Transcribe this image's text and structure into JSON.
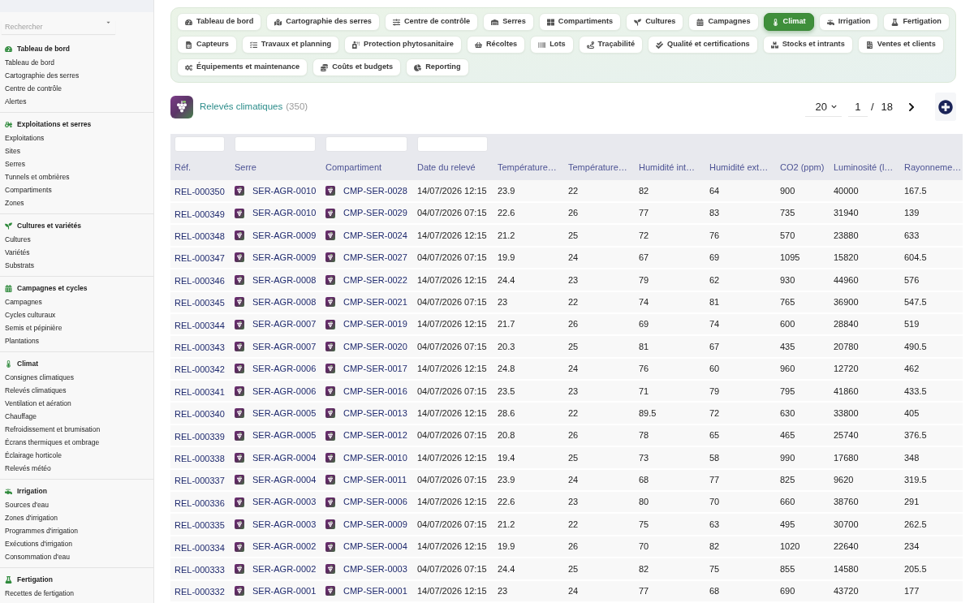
{
  "sidebar": {
    "search": {
      "placeholder": "Rechercher"
    },
    "sections": [
      {
        "title": "Tableau de bord",
        "items": [
          "Tableau de bord",
          "Cartographie des serres",
          "Centre de contrôle",
          "Alertes"
        ]
      },
      {
        "title": "Exploitations et serres",
        "items": [
          "Exploitations",
          "Sites",
          "Serres",
          "Tunnels et ombrières",
          "Compartiments",
          "Zones"
        ]
      },
      {
        "title": "Cultures et variétés",
        "items": [
          "Cultures",
          "Variétés",
          "Substrats"
        ]
      },
      {
        "title": "Campagnes et cycles",
        "items": [
          "Campagnes",
          "Cycles culturaux",
          "Semis et pépinière",
          "Plantations"
        ]
      },
      {
        "title": "Climat",
        "items": [
          "Consignes climatiques",
          "Relevés climatiques",
          "Ventilation et aération",
          "Chauffage",
          "Refroidissement et brumisation",
          "Écrans thermiques et ombrage",
          "Éclairage horticole",
          "Relevés météo"
        ]
      },
      {
        "title": "Irrigation",
        "items": [
          "Sources d'eau",
          "Zones d'irrigation",
          "Programmes d'irrigation",
          "Exécutions d'irrigation",
          "Consommation d'eau"
        ]
      },
      {
        "title": "Fertigation",
        "items": [
          "Recettes de fertigation"
        ]
      }
    ]
  },
  "nav": {
    "tabs": [
      {
        "label": "Tableau de bord",
        "selected": false
      },
      {
        "label": "Cartographie des serres",
        "selected": false
      },
      {
        "label": "Centre de contrôle",
        "selected": false
      },
      {
        "label": "Serres",
        "selected": false
      },
      {
        "label": "Compartiments",
        "selected": false
      },
      {
        "label": "Cultures",
        "selected": false
      },
      {
        "label": "Campagnes",
        "selected": false
      },
      {
        "label": "Climat",
        "selected": true
      },
      {
        "label": "Irrigation",
        "selected": false
      },
      {
        "label": "Fertigation",
        "selected": false
      },
      {
        "label": "Capteurs",
        "selected": false
      },
      {
        "label": "Travaux et planning",
        "selected": false
      },
      {
        "label": "Protection phytosanitaire",
        "selected": false
      },
      {
        "label": "Récoltes",
        "selected": false
      },
      {
        "label": "Lots",
        "selected": false
      },
      {
        "label": "Traçabilité",
        "selected": false
      },
      {
        "label": "Qualité et certifications",
        "selected": false
      },
      {
        "label": "Stocks et intrants",
        "selected": false
      },
      {
        "label": "Ventes et clients",
        "selected": false
      },
      {
        "label": "Équipements et maintenance",
        "selected": false
      },
      {
        "label": "Coûts et budgets",
        "selected": false
      },
      {
        "label": "Reporting",
        "selected": false
      }
    ]
  },
  "header": {
    "title": "Relevés climatiques",
    "count": "(350)"
  },
  "pagination": {
    "page_size": "20",
    "page": "1",
    "separator": "/",
    "total_pages": "18"
  },
  "table": {
    "columns": [
      {
        "label": "Réf.",
        "kind": "link",
        "filter": true
      },
      {
        "label": "Serre",
        "kind": "icon_link",
        "filter": true
      },
      {
        "label": "Compartiment",
        "kind": "icon_link",
        "filter": true
      },
      {
        "label": "Date du relevé",
        "kind": "text",
        "filter": true
      },
      {
        "label": "Température…",
        "kind": "text",
        "filter": false
      },
      {
        "label": "Température…",
        "kind": "text",
        "filter": false
      },
      {
        "label": "Humidité int…",
        "kind": "text",
        "filter": false
      },
      {
        "label": "Humidité ext…",
        "kind": "text",
        "filter": false
      },
      {
        "label": "CO2 (ppm)",
        "kind": "text",
        "filter": false
      },
      {
        "label": "Luminosité (l…",
        "kind": "text",
        "filter": false
      },
      {
        "label": "Rayonneme…",
        "kind": "text",
        "filter": false
      }
    ],
    "rows": [
      [
        "REL-000350",
        "SER-AGR-0010",
        "CMP-SER-0028",
        "14/07/2026 12:15",
        "23.9",
        "22",
        "82",
        "64",
        "900",
        "40000",
        "167.5"
      ],
      [
        "REL-000349",
        "SER-AGR-0010",
        "CMP-SER-0029",
        "04/07/2026 07:15",
        "22.6",
        "26",
        "77",
        "83",
        "735",
        "31940",
        "139"
      ],
      [
        "REL-000348",
        "SER-AGR-0009",
        "CMP-SER-0024",
        "14/07/2026 12:15",
        "21.2",
        "25",
        "72",
        "76",
        "570",
        "23880",
        "633"
      ],
      [
        "REL-000347",
        "SER-AGR-0009",
        "CMP-SER-0027",
        "04/07/2026 07:15",
        "19.9",
        "24",
        "67",
        "69",
        "1095",
        "15820",
        "604.5"
      ],
      [
        "REL-000346",
        "SER-AGR-0008",
        "CMP-SER-0022",
        "14/07/2026 12:15",
        "24.4",
        "23",
        "79",
        "62",
        "930",
        "44960",
        "576"
      ],
      [
        "REL-000345",
        "SER-AGR-0008",
        "CMP-SER-0021",
        "04/07/2026 07:15",
        "23",
        "22",
        "74",
        "81",
        "765",
        "36900",
        "547.5"
      ],
      [
        "REL-000344",
        "SER-AGR-0007",
        "CMP-SER-0019",
        "14/07/2026 12:15",
        "21.7",
        "26",
        "69",
        "74",
        "600",
        "28840",
        "519"
      ],
      [
        "REL-000343",
        "SER-AGR-0007",
        "CMP-SER-0020",
        "04/07/2026 07:15",
        "20.3",
        "25",
        "81",
        "67",
        "435",
        "20780",
        "490.5"
      ],
      [
        "REL-000342",
        "SER-AGR-0006",
        "CMP-SER-0017",
        "14/07/2026 12:15",
        "24.8",
        "24",
        "76",
        "60",
        "960",
        "12720",
        "462"
      ],
      [
        "REL-000341",
        "SER-AGR-0006",
        "CMP-SER-0016",
        "04/07/2026 07:15",
        "23.5",
        "23",
        "71",
        "79",
        "795",
        "41860",
        "433.5"
      ],
      [
        "REL-000340",
        "SER-AGR-0005",
        "CMP-SER-0013",
        "14/07/2026 12:15",
        "28.6",
        "22",
        "89.5",
        "72",
        "630",
        "33800",
        "405"
      ],
      [
        "REL-000339",
        "SER-AGR-0005",
        "CMP-SER-0012",
        "04/07/2026 07:15",
        "20.8",
        "26",
        "78",
        "65",
        "465",
        "25740",
        "376.5"
      ],
      [
        "REL-000338",
        "SER-AGR-0004",
        "CMP-SER-0010",
        "14/07/2026 12:15",
        "19.4",
        "25",
        "73",
        "58",
        "990",
        "17680",
        "348"
      ],
      [
        "REL-000337",
        "SER-AGR-0004",
        "CMP-SER-0011",
        "04/07/2026 07:15",
        "23.9",
        "24",
        "68",
        "77",
        "825",
        "9620",
        "319.5"
      ],
      [
        "REL-000336",
        "SER-AGR-0003",
        "CMP-SER-0006",
        "14/07/2026 12:15",
        "22.6",
        "23",
        "80",
        "70",
        "660",
        "38760",
        "291"
      ],
      [
        "REL-000335",
        "SER-AGR-0003",
        "CMP-SER-0009",
        "04/07/2026 07:15",
        "21.2",
        "22",
        "75",
        "63",
        "495",
        "30700",
        "262.5"
      ],
      [
        "REL-000334",
        "SER-AGR-0002",
        "CMP-SER-0004",
        "14/07/2026 12:15",
        "19.9",
        "26",
        "70",
        "82",
        "1020",
        "22640",
        "234"
      ],
      [
        "REL-000333",
        "SER-AGR-0002",
        "CMP-SER-0003",
        "04/07/2026 07:15",
        "24.4",
        "25",
        "82",
        "75",
        "855",
        "14580",
        "205.5"
      ],
      [
        "REL-000332",
        "SER-AGR-0001",
        "CMP-SER-0001",
        "14/07/2026 12:15",
        "23",
        "24",
        "77",
        "68",
        "690",
        "43720",
        "177"
      ]
    ]
  }
}
